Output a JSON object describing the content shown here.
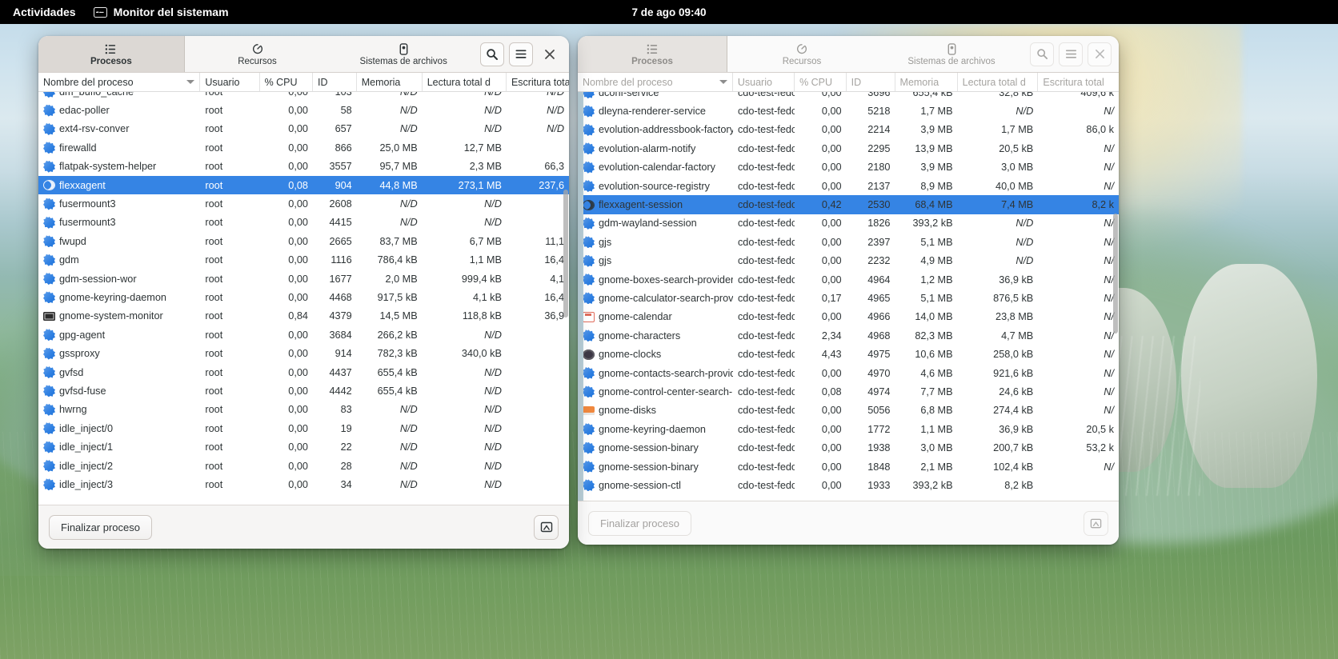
{
  "topbar": {
    "activities": "Actividades",
    "app_name": "Monitor del sistemam",
    "app_icon": "system-monitor-icon",
    "clock": "7 de ago  09:40"
  },
  "tabs": [
    {
      "label": "Procesos",
      "icon": "list-icon"
    },
    {
      "label": "Recursos",
      "icon": "speedometer-icon"
    },
    {
      "label": "Sistemas de archivos",
      "icon": "drive-icon"
    }
  ],
  "columns": [
    "Nombre del proceso",
    "Usuario",
    "% CPU",
    "ID",
    "Memoria",
    "Lectura total d",
    "Escritura total"
  ],
  "actions": {
    "end_process": "Finalizar proceso",
    "search_icon": "search-icon",
    "menu_icon": "hamburger-menu-icon",
    "close_icon": "close-icon",
    "details_icon": "process-details-icon"
  },
  "colors": {
    "selection": "#3584e4",
    "headerbar": "#f6f5f4",
    "active_tab": "#dcd8d4",
    "topbar": "#000000"
  },
  "left_window": {
    "active": true,
    "active_tab": "Procesos",
    "rows": [
      {
        "name": "dm_bufio_cache",
        "icon": "gear",
        "user": "root",
        "cpu": "0,00",
        "id": "103",
        "mem": "N/D",
        "read": "N/D",
        "write": "N/D",
        "mem_nd": true,
        "read_nd": true,
        "write_nd": true
      },
      {
        "name": "edac-poller",
        "icon": "gear",
        "user": "root",
        "cpu": "0,00",
        "id": "58",
        "mem": "N/D",
        "read": "N/D",
        "write": "N/D",
        "mem_nd": true,
        "read_nd": true,
        "write_nd": true
      },
      {
        "name": "ext4-rsv-conver",
        "icon": "gear",
        "user": "root",
        "cpu": "0,00",
        "id": "657",
        "mem": "N/D",
        "read": "N/D",
        "write": "N/D",
        "mem_nd": true,
        "read_nd": true,
        "write_nd": true
      },
      {
        "name": "firewalld",
        "icon": "gear",
        "user": "root",
        "cpu": "0,00",
        "id": "866",
        "mem": "25,0 MB",
        "read": "12,7 MB",
        "write": ""
      },
      {
        "name": "flatpak-system-helper",
        "icon": "gear",
        "user": "root",
        "cpu": "0,00",
        "id": "3557",
        "mem": "95,7 MB",
        "read": "2,3 MB",
        "write": "66,3"
      },
      {
        "name": "flexxagent",
        "icon": "moon",
        "user": "root",
        "cpu": "0,08",
        "id": "904",
        "mem": "44,8 MB",
        "read": "273,1 MB",
        "write": "237,6",
        "selected": true
      },
      {
        "name": "fusermount3",
        "icon": "gear",
        "user": "root",
        "cpu": "0,00",
        "id": "2608",
        "mem": "N/D",
        "read": "N/D",
        "write": "",
        "mem_nd": true,
        "read_nd": true
      },
      {
        "name": "fusermount3",
        "icon": "gear",
        "user": "root",
        "cpu": "0,00",
        "id": "4415",
        "mem": "N/D",
        "read": "N/D",
        "write": "",
        "mem_nd": true,
        "read_nd": true
      },
      {
        "name": "fwupd",
        "icon": "gear",
        "user": "root",
        "cpu": "0,00",
        "id": "2665",
        "mem": "83,7 MB",
        "read": "6,7 MB",
        "write": "11,1"
      },
      {
        "name": "gdm",
        "icon": "gear",
        "user": "root",
        "cpu": "0,00",
        "id": "1116",
        "mem": "786,4 kB",
        "read": "1,1 MB",
        "write": "16,4"
      },
      {
        "name": "gdm-session-wor",
        "icon": "gear",
        "user": "root",
        "cpu": "0,00",
        "id": "1677",
        "mem": "2,0 MB",
        "read": "999,4 kB",
        "write": "4,1"
      },
      {
        "name": "gnome-keyring-daemon",
        "icon": "gear",
        "user": "root",
        "cpu": "0,00",
        "id": "4468",
        "mem": "917,5 kB",
        "read": "4,1 kB",
        "write": "16,4"
      },
      {
        "name": "gnome-system-monitor",
        "icon": "monitor",
        "user": "root",
        "cpu": "0,84",
        "id": "4379",
        "mem": "14,5 MB",
        "read": "118,8 kB",
        "write": "36,9"
      },
      {
        "name": "gpg-agent",
        "icon": "gear",
        "user": "root",
        "cpu": "0,00",
        "id": "3684",
        "mem": "266,2 kB",
        "read": "N/D",
        "write": "",
        "read_nd": true
      },
      {
        "name": "gssproxy",
        "icon": "gear",
        "user": "root",
        "cpu": "0,00",
        "id": "914",
        "mem": "782,3 kB",
        "read": "340,0 kB",
        "write": ""
      },
      {
        "name": "gvfsd",
        "icon": "gear",
        "user": "root",
        "cpu": "0,00",
        "id": "4437",
        "mem": "655,4 kB",
        "read": "N/D",
        "write": "",
        "read_nd": true
      },
      {
        "name": "gvfsd-fuse",
        "icon": "gear",
        "user": "root",
        "cpu": "0,00",
        "id": "4442",
        "mem": "655,4 kB",
        "read": "N/D",
        "write": "",
        "read_nd": true
      },
      {
        "name": "hwrng",
        "icon": "gear",
        "user": "root",
        "cpu": "0,00",
        "id": "83",
        "mem": "N/D",
        "read": "N/D",
        "write": "",
        "mem_nd": true,
        "read_nd": true
      },
      {
        "name": "idle_inject/0",
        "icon": "gear",
        "user": "root",
        "cpu": "0,00",
        "id": "19",
        "mem": "N/D",
        "read": "N/D",
        "write": "",
        "mem_nd": true,
        "read_nd": true
      },
      {
        "name": "idle_inject/1",
        "icon": "gear",
        "user": "root",
        "cpu": "0,00",
        "id": "22",
        "mem": "N/D",
        "read": "N/D",
        "write": "",
        "mem_nd": true,
        "read_nd": true
      },
      {
        "name": "idle_inject/2",
        "icon": "gear",
        "user": "root",
        "cpu": "0,00",
        "id": "28",
        "mem": "N/D",
        "read": "N/D",
        "write": "",
        "mem_nd": true,
        "read_nd": true
      },
      {
        "name": "idle_inject/3",
        "icon": "gear",
        "user": "root",
        "cpu": "0,00",
        "id": "34",
        "mem": "N/D",
        "read": "N/D",
        "write": "",
        "mem_nd": true,
        "read_nd": true
      }
    ]
  },
  "right_window": {
    "active": false,
    "active_tab": "Procesos",
    "rows": [
      {
        "name": "dconf-service",
        "icon": "gear",
        "user": "cdo-test-fedor",
        "cpu": "0,00",
        "id": "3696",
        "mem": "655,4 kB",
        "read": "32,8 kB",
        "write": "409,6 k"
      },
      {
        "name": "dleyna-renderer-service",
        "icon": "gear",
        "user": "cdo-test-fedor",
        "cpu": "0,00",
        "id": "5218",
        "mem": "1,7 MB",
        "read": "N/D",
        "write": "N/",
        "read_nd": true,
        "write_nd": true
      },
      {
        "name": "evolution-addressbook-factory",
        "icon": "gear",
        "user": "cdo-test-fedor",
        "cpu": "0,00",
        "id": "2214",
        "mem": "3,9 MB",
        "read": "1,7 MB",
        "write": "86,0 k"
      },
      {
        "name": "evolution-alarm-notify",
        "icon": "gear",
        "user": "cdo-test-fedor",
        "cpu": "0,00",
        "id": "2295",
        "mem": "13,9 MB",
        "read": "20,5 kB",
        "write": "N/",
        "write_nd": true
      },
      {
        "name": "evolution-calendar-factory",
        "icon": "gear",
        "user": "cdo-test-fedor",
        "cpu": "0,00",
        "id": "2180",
        "mem": "3,9 MB",
        "read": "3,0 MB",
        "write": "N/",
        "write_nd": true
      },
      {
        "name": "evolution-source-registry",
        "icon": "gear",
        "user": "cdo-test-fedor",
        "cpu": "0,00",
        "id": "2137",
        "mem": "8,9 MB",
        "read": "40,0 MB",
        "write": "N/",
        "write_nd": true
      },
      {
        "name": "flexxagent-session",
        "icon": "moon",
        "user": "cdo-test-fedor",
        "cpu": "0,42",
        "id": "2530",
        "mem": "68,4 MB",
        "read": "7,4 MB",
        "write": "8,2 k",
        "selected": true
      },
      {
        "name": "gdm-wayland-session",
        "icon": "gear",
        "user": "cdo-test-fedor",
        "cpu": "0,00",
        "id": "1826",
        "mem": "393,2 kB",
        "read": "N/D",
        "write": "N/",
        "read_nd": true,
        "write_nd": true
      },
      {
        "name": "gjs",
        "icon": "gear",
        "user": "cdo-test-fedor",
        "cpu": "0,00",
        "id": "2397",
        "mem": "5,1 MB",
        "read": "N/D",
        "write": "N/",
        "read_nd": true,
        "write_nd": true
      },
      {
        "name": "gjs",
        "icon": "gear",
        "user": "cdo-test-fedor",
        "cpu": "0,00",
        "id": "2232",
        "mem": "4,9 MB",
        "read": "N/D",
        "write": "N/",
        "read_nd": true,
        "write_nd": true
      },
      {
        "name": "gnome-boxes-search-provider",
        "icon": "gear",
        "user": "cdo-test-fedor",
        "cpu": "0,00",
        "id": "4964",
        "mem": "1,2 MB",
        "read": "36,9 kB",
        "write": "N/",
        "write_nd": true
      },
      {
        "name": "gnome-calculator-search-provi",
        "icon": "gear",
        "user": "cdo-test-fedor",
        "cpu": "0,17",
        "id": "4965",
        "mem": "5,1 MB",
        "read": "876,5 kB",
        "write": "N/",
        "write_nd": true
      },
      {
        "name": "gnome-calendar",
        "icon": "calendar",
        "user": "cdo-test-fedor",
        "cpu": "0,00",
        "id": "4966",
        "mem": "14,0 MB",
        "read": "23,8 MB",
        "write": "N/",
        "write_nd": true
      },
      {
        "name": "gnome-characters",
        "icon": "gear",
        "user": "cdo-test-fedor",
        "cpu": "2,34",
        "id": "4968",
        "mem": "82,3 MB",
        "read": "4,7 MB",
        "write": "N/",
        "write_nd": true
      },
      {
        "name": "gnome-clocks",
        "icon": "clock",
        "user": "cdo-test-fedor",
        "cpu": "4,43",
        "id": "4975",
        "mem": "10,6 MB",
        "read": "258,0 kB",
        "write": "N/",
        "write_nd": true
      },
      {
        "name": "gnome-contacts-search-provid",
        "icon": "gear",
        "user": "cdo-test-fedor",
        "cpu": "0,00",
        "id": "4970",
        "mem": "4,6 MB",
        "read": "921,6 kB",
        "write": "N/",
        "write_nd": true
      },
      {
        "name": "gnome-control-center-search-",
        "icon": "gear",
        "user": "cdo-test-fedor",
        "cpu": "0,08",
        "id": "4974",
        "mem": "7,7 MB",
        "read": "24,6 kB",
        "write": "N/",
        "write_nd": true
      },
      {
        "name": "gnome-disks",
        "icon": "disks",
        "user": "cdo-test-fedor",
        "cpu": "0,00",
        "id": "5056",
        "mem": "6,8 MB",
        "read": "274,4 kB",
        "write": "N/",
        "write_nd": true
      },
      {
        "name": "gnome-keyring-daemon",
        "icon": "gear",
        "user": "cdo-test-fedor",
        "cpu": "0,00",
        "id": "1772",
        "mem": "1,1 MB",
        "read": "36,9 kB",
        "write": "20,5 k"
      },
      {
        "name": "gnome-session-binary",
        "icon": "gear",
        "user": "cdo-test-fedor",
        "cpu": "0,00",
        "id": "1938",
        "mem": "3,0 MB",
        "read": "200,7 kB",
        "write": "53,2 k"
      },
      {
        "name": "gnome-session-binary",
        "icon": "gear",
        "user": "cdo-test-fedor",
        "cpu": "0,00",
        "id": "1848",
        "mem": "2,1 MB",
        "read": "102,4 kB",
        "write": "N/",
        "write_nd": true
      },
      {
        "name": "gnome-session-ctl",
        "icon": "gear",
        "user": "cdo-test-fedor",
        "cpu": "0,00",
        "id": "1933",
        "mem": "393,2 kB",
        "read": "8,2 kB",
        "write": ""
      }
    ]
  }
}
